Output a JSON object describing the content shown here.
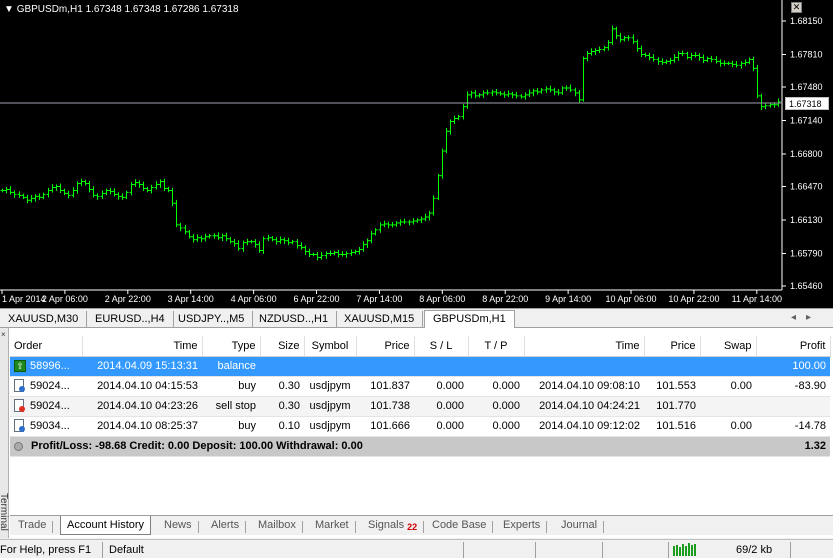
{
  "chart": {
    "title": "GBPUSDm,H1  1.67348 1.67348 1.67286 1.67318",
    "current_price": "1.67318",
    "price_levels": [
      "1.68150",
      "1.67810",
      "1.67480",
      "1.67140",
      "1.66800",
      "1.66470",
      "1.66130",
      "1.65790",
      "1.65460"
    ],
    "time_labels": [
      "1 Apr 2014",
      "2 Apr 06:00",
      "2 Apr 22:00",
      "3 Apr 14:00",
      "4 Apr 06:00",
      "6 Apr 22:00",
      "7 Apr 14:00",
      "8 Apr 06:00",
      "8 Apr 22:00",
      "9 Apr 14:00",
      "10 Apr 06:00",
      "10 Apr 22:00",
      "11 Apr 14:00"
    ],
    "bar_color": "#00ff00",
    "background": "#000000",
    "close_series": [
      1.6643,
      1.6644,
      1.6641,
      1.6639,
      1.6638,
      1.6636,
      1.6633,
      1.6635,
      1.6637,
      1.6636,
      1.6639,
      1.6643,
      1.6646,
      1.6647,
      1.6643,
      1.664,
      1.6638,
      1.6643,
      1.665,
      1.6652,
      1.665,
      1.6644,
      1.6638,
      1.6637,
      1.664,
      1.6643,
      1.6642,
      1.6639,
      1.6637,
      1.6636,
      1.6641,
      1.6649,
      1.6651,
      1.6649,
      1.6645,
      1.6643,
      1.6646,
      1.6649,
      1.6652,
      1.6645,
      1.6643,
      1.663,
      1.6608,
      1.6605,
      1.6601,
      1.6596,
      1.6593,
      1.6595,
      1.6594,
      1.6596,
      1.6597,
      1.6597,
      1.6595,
      1.6597,
      1.6594,
      1.6591,
      1.6589,
      1.6584,
      1.659,
      1.6591,
      1.6591,
      1.6588,
      1.6582,
      1.6594,
      1.6595,
      1.6593,
      1.6591,
      1.6593,
      1.6592,
      1.659,
      1.6591,
      1.6587,
      1.6585,
      1.6581,
      1.6578,
      1.6578,
      1.6575,
      1.6577,
      1.6579,
      1.6579,
      1.658,
      1.6578,
      1.6578,
      1.6579,
      1.658,
      1.6581,
      1.6583,
      1.6588,
      1.6592,
      1.6599,
      1.6603,
      1.6608,
      1.6609,
      1.6608,
      1.6608,
      1.661,
      1.6611,
      1.6611,
      1.6611,
      1.6612,
      1.6613,
      1.6614,
      1.6616,
      1.662,
      1.6635,
      1.6658,
      1.6683,
      1.6703,
      1.6713,
      1.6716,
      1.6718,
      1.6728,
      1.674,
      1.6742,
      1.6739,
      1.674,
      1.6742,
      1.6742,
      1.6743,
      1.6742,
      1.6741,
      1.674,
      1.6741,
      1.674,
      1.6739,
      1.6738,
      1.674,
      1.6742,
      1.6744,
      1.6743,
      1.6745,
      1.6746,
      1.6745,
      1.6743,
      1.6742,
      1.6747,
      1.6747,
      1.6745,
      1.6742,
      1.6735,
      1.6777,
      1.6782,
      1.6784,
      1.6785,
      1.6786,
      1.6788,
      1.6793,
      1.6807,
      1.68,
      1.6796,
      1.6798,
      1.6798,
      1.6794,
      1.6787,
      1.6781,
      1.678,
      1.6778,
      1.6776,
      1.6774,
      1.6773,
      1.6774,
      1.6775,
      1.6778,
      1.6782,
      1.6782,
      1.6778,
      1.678,
      1.678,
      1.6778,
      1.6775,
      1.6777,
      1.6776,
      1.6774,
      1.6772,
      1.6772,
      1.6772,
      1.6771,
      1.677,
      1.6772,
      1.6773,
      1.6776,
      1.6767,
      1.6739,
      1.6728,
      1.6729,
      1.673,
      1.673,
      1.6733
    ]
  },
  "chart_tabs": [
    "XAUUSD,M30",
    "EURUSD..,H4",
    "USDJPY..,M5",
    "NZDUSD..,H1",
    "XAUUSD,M15",
    "GBPUSDm,H1"
  ],
  "terminal": {
    "side_label": "Terminal",
    "columns": [
      "Order",
      "Time",
      "Type",
      "Size",
      "Symbol",
      "Price",
      "S / L",
      "T / P",
      "Time",
      "Price",
      "Swap",
      "Profit"
    ],
    "rows": [
      {
        "icon": "balance-icon",
        "order": "58996...",
        "time": "2014.04.09 15:13:31",
        "type": "balance",
        "size": "",
        "symbol": "",
        "price": "",
        "sl": "",
        "tp": "",
        "close_time": "",
        "close_price": "",
        "swap": "",
        "profit": "100.00"
      },
      {
        "icon": "order-filled-icon",
        "order": "59024...",
        "time": "2014.04.10 04:15:53",
        "type": "buy",
        "size": "0.30",
        "symbol": "usdjpym",
        "price": "101.837",
        "sl": "0.000",
        "tp": "0.000",
        "close_time": "2014.04.10 09:08:10",
        "close_price": "101.553",
        "swap": "0.00",
        "profit": "-83.90"
      },
      {
        "icon": "order-cancelled-icon",
        "order": "59024...",
        "time": "2014.04.10 04:23:26",
        "type": "sell stop",
        "size": "0.30",
        "symbol": "usdjpym",
        "price": "101.738",
        "sl": "0.000",
        "tp": "0.000",
        "close_time": "2014.04.10 04:24:21",
        "close_price": "101.770",
        "swap": "",
        "profit": ""
      },
      {
        "icon": "order-filled-icon",
        "order": "59034...",
        "time": "2014.04.10 08:25:37",
        "type": "buy",
        "size": "0.10",
        "symbol": "usdjpym",
        "price": "101.666",
        "sl": "0.000",
        "tp": "0.000",
        "close_time": "2014.04.10 09:12:02",
        "close_price": "101.516",
        "swap": "0.00",
        "profit": "-14.78"
      }
    ],
    "summary_text": "Profit/Loss: -98.68  Credit: 0.00  Deposit: 100.00  Withdrawal: 0.00",
    "summary_total": "1.32"
  },
  "terminal_tabs": [
    {
      "label": "Trade"
    },
    {
      "label": "Account History"
    },
    {
      "label": "News"
    },
    {
      "label": "Alerts"
    },
    {
      "label": "Mailbox"
    },
    {
      "label": "Market"
    },
    {
      "label": "Signals",
      "badge": "22"
    },
    {
      "label": "Code Base"
    },
    {
      "label": "Experts"
    },
    {
      "label": "Journal"
    }
  ],
  "statusbar": {
    "help": "For Help, press F1",
    "profile": "Default",
    "traffic": "69/2 kb"
  },
  "colors": {
    "selected_row": "#3399ff",
    "summary_row": "#c8c8c8",
    "signals_badge": "#d00000"
  }
}
